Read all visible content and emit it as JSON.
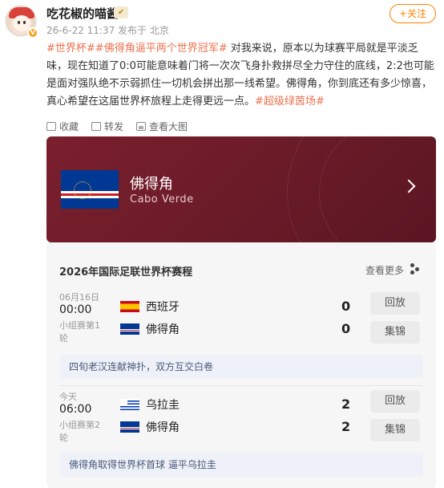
{
  "header": {
    "username": "吃花椒的喵酱",
    "level_badge": "✔",
    "meta": "26-6-22 11:37 发布于 北京",
    "follow_label": "+关注"
  },
  "post": {
    "tag1": "#世界杯#",
    "tag2": "#佛得角逼平两个世界冠军#",
    "body": " 对我来说，原本以为球赛平局就是平淡乏味，现在知道了0:0可能意味着门将一次次飞身扑救拼尽全力守住的底线，2:2也可能是面对强队绝不示弱抓住一切机会拼出那一线希望。佛得角，你到底还有多少惊喜，真心希望在这届世界杯旅程上走得更远一点。",
    "tag3": "#超级绿茵场#"
  },
  "actions": {
    "collect": "收藏",
    "share": "转发",
    "pictures": "查看大图"
  },
  "card": {
    "team_cn": "佛得角",
    "team_en": "Cabo Verde",
    "schedule_title": "2026年国际足联世界杯赛程",
    "more_label": "查看更多",
    "matches": [
      {
        "date": "06月16日",
        "time": "00:00",
        "round": "小组赛第1轮",
        "home": "西班牙",
        "away": "佛得角",
        "home_score": "0",
        "away_score": "0",
        "btn1": "回放",
        "btn2": "集锦",
        "note": "四旬老汉连献神扑，双方互交白卷"
      },
      {
        "date": "今天",
        "time": "06:00",
        "round": "小组赛第2轮",
        "home": "乌拉圭",
        "away": "佛得角",
        "home_score": "2",
        "away_score": "2",
        "btn1": "回放",
        "btn2": "集锦",
        "note": "佛得角取得世界杯首球 逼平乌拉圭"
      }
    ]
  },
  "colors": {
    "accent": "#ff8200",
    "tag": "#eb7350",
    "banner": "#6a1b28"
  }
}
